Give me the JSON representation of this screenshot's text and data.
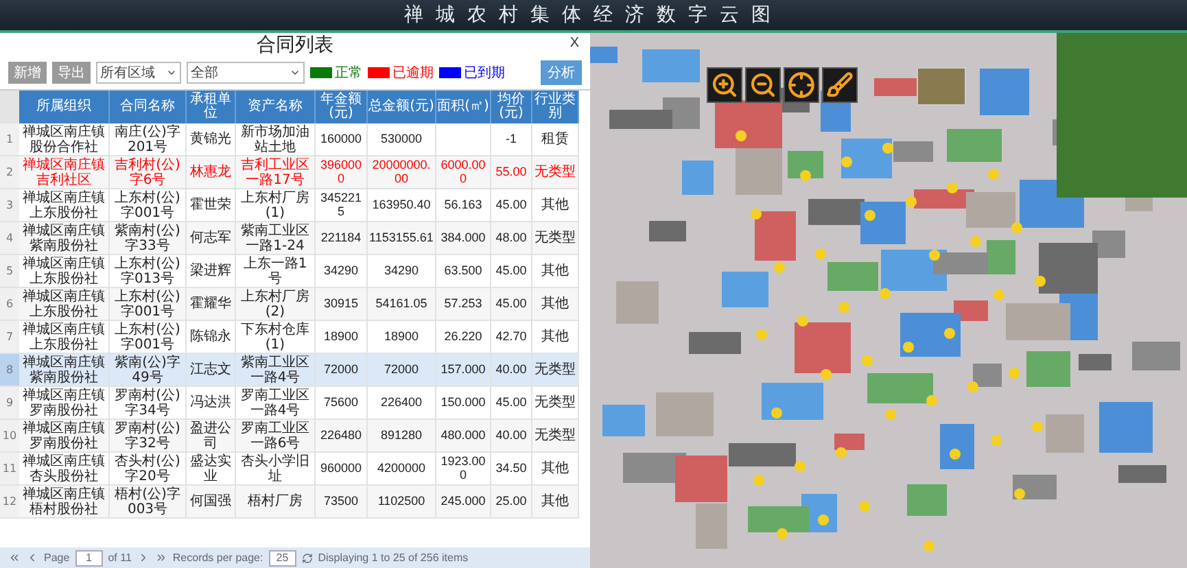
{
  "header": {
    "title": "禅城农村集体经济数字云图"
  },
  "dialog": {
    "title": "合同列表",
    "close": "X"
  },
  "toolbar": {
    "buttons": [
      "新增",
      "导出"
    ],
    "region_select": "所有区域",
    "filter_select": "全部",
    "search_button": "分析",
    "legend": [
      {
        "label": "正常",
        "color": "#0a7a0a"
      },
      {
        "label": "已逾期",
        "color": "#ff0000"
      },
      {
        "label": "已到期",
        "color": "#0000ff"
      }
    ]
  },
  "table": {
    "columns": [
      "所属组织",
      "合同名称",
      "承租单位",
      "资产名称",
      "年金额(元)",
      "总金额(元)",
      "面积(㎡)",
      "均价(元)",
      "行业类别"
    ],
    "rows": [
      {
        "number": "1",
        "color": "#222222",
        "selected": false,
        "cells": [
          "禅城区南庄镇股份合作社",
          "南庄(公)字201号",
          "黄锦光",
          "新市场加油站土地",
          "160000",
          "530000",
          null,
          "-1",
          "租赁"
        ]
      },
      {
        "number": "2",
        "color": "#ff0000",
        "selected": false,
        "cells": [
          "禅城区南庄镇吉利社区",
          "吉利村(公)字6号",
          "林惠龙",
          "吉利工业区一路17号",
          "3960000",
          "20000000.00",
          "6000.000",
          "55.00",
          "无类型"
        ]
      },
      {
        "number": "3",
        "color": "#222222",
        "selected": false,
        "cells": [
          "禅城区南庄镇上东股份社",
          "上东村(公)字001号",
          "霍世荣",
          "上东村厂房(1)",
          "3452215",
          "163950.40",
          "56.163",
          "45.00",
          "其他"
        ]
      },
      {
        "number": "4",
        "color": "#222222",
        "selected": false,
        "cells": [
          "禅城区南庄镇紫南股份社",
          "紫南村(公)字33号",
          "何志军",
          "紫南工业区一路1-24",
          "221184",
          "1153155.61",
          "384.000",
          "48.00",
          "无类型"
        ]
      },
      {
        "number": "5",
        "color": "#222222",
        "selected": false,
        "cells": [
          "禅城区南庄镇上东股份社",
          "上东村(公)字013号",
          "梁进辉",
          "上东一路1号",
          "34290",
          "34290",
          "63.500",
          "45.00",
          "其他"
        ]
      },
      {
        "number": "6",
        "color": "#222222",
        "selected": false,
        "cells": [
          "禅城区南庄镇上东股份社",
          "上东村(公)字001号",
          "霍耀华",
          "上东村厂房(2)",
          "30915",
          "54161.05",
          "57.253",
          "45.00",
          "其他"
        ]
      },
      {
        "number": "7",
        "color": "#222222",
        "selected": false,
        "cells": [
          "禅城区南庄镇上东股份社",
          "上东村(公)字001号",
          "陈锦永",
          "下东村仓库(1)",
          "18900",
          "18900",
          "26.220",
          "42.70",
          "其他"
        ]
      },
      {
        "number": "8",
        "color": "#222222",
        "selected": true,
        "cells": [
          "禅城区南庄镇紫南股份社",
          "紫南(公)字49号",
          "江志文",
          "紫南工业区一路4号",
          "72000",
          "72000",
          "157.000",
          "40.00",
          "无类型"
        ]
      },
      {
        "number": "9",
        "color": "#222222",
        "selected": false,
        "cells": [
          "禅城区南庄镇罗南股份社",
          "罗南村(公)字34号",
          "冯达洪",
          "罗南工业区一路4号",
          "75600",
          "226400",
          "150.000",
          "45.00",
          "无类型"
        ]
      },
      {
        "number": "10",
        "color": "#222222",
        "selected": false,
        "cells": [
          "禅城区南庄镇罗南股份社",
          "罗南村(公)字32号",
          "盈进公司",
          "罗南工业区一路6号",
          "226480",
          "891280",
          "480.000",
          "40.00",
          "无类型"
        ]
      },
      {
        "number": "11",
        "color": "#222222",
        "selected": false,
        "cells": [
          "禅城区南庄镇杏头股份社",
          "杏头村(公)字20号",
          "盛达实业",
          "杏头小学旧址",
          "960000",
          "4200000",
          "1923.000",
          "34.50",
          "其他"
        ]
      },
      {
        "number": "12",
        "color": "#222222",
        "selected": false,
        "cells": [
          "禅城区南庄镇梧村股份社",
          "梧村(公)字003号",
          "何国强",
          "梧村厂房",
          "73500",
          "1102500",
          "245.000",
          "25.00",
          "其他"
        ]
      }
    ]
  },
  "pager": {
    "page_label": "Page",
    "page": "1",
    "of_label": "of 11",
    "per_page_label": "Records per page:",
    "per_page": "25",
    "summary": "Displaying 1 to 25 of 256 items"
  },
  "map": {
    "tools": [
      {
        "kind": "zoom_in"
      },
      {
        "kind": "zoom_out"
      },
      {
        "kind": "locate"
      },
      {
        "kind": "clear"
      }
    ]
  }
}
